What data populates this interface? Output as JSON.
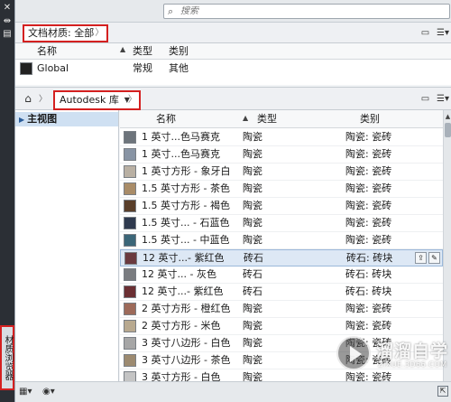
{
  "left_strip": {
    "vertical_title": "材质浏览器",
    "icons": [
      "close-icon",
      "pin-icon",
      "properties-icon"
    ]
  },
  "search": {
    "placeholder": "搜索"
  },
  "doc_materials": {
    "breadcrumb": "文档材质: 全部",
    "columns": {
      "name": "名称",
      "type": "类型",
      "category": "类别"
    },
    "rows": [
      {
        "name": "Global",
        "type": "常规",
        "category": "其他",
        "swatch": "#222222"
      }
    ]
  },
  "library": {
    "breadcrumb": "Autodesk 库",
    "tree": {
      "items": [
        {
          "label": "主视图"
        }
      ]
    },
    "columns": {
      "name": "名称",
      "type": "类型",
      "category": "类别"
    },
    "rows": [
      {
        "name": "1 英寸...色马赛克",
        "type": "陶瓷",
        "category": "陶瓷: 瓷砖",
        "swatch": "#6d747b"
      },
      {
        "name": "1 英寸...色马赛克",
        "type": "陶瓷",
        "category": "陶瓷: 瓷砖",
        "swatch": "#8894a4"
      },
      {
        "name": "1 英寸方形 - 象牙白",
        "type": "陶瓷",
        "category": "陶瓷: 瓷砖",
        "swatch": "#b9b0a3"
      },
      {
        "name": "1.5 英寸方形 - 茶色",
        "type": "陶瓷",
        "category": "陶瓷: 瓷砖",
        "swatch": "#a98c68"
      },
      {
        "name": "1.5 英寸方形 - 褐色",
        "type": "陶瓷",
        "category": "陶瓷: 瓷砖",
        "swatch": "#5a3f2a"
      },
      {
        "name": "1.5 英寸... - 石蓝色",
        "type": "陶瓷",
        "category": "陶瓷: 瓷砖",
        "swatch": "#2f3a4e"
      },
      {
        "name": "1.5 英寸... - 中蓝色",
        "type": "陶瓷",
        "category": "陶瓷: 瓷砖",
        "swatch": "#3b6678"
      },
      {
        "name": "12 英寸...- 紫红色",
        "type": "砖石",
        "category": "砖石: 砖块",
        "swatch": "#6a3a3f",
        "selected": true
      },
      {
        "name": "12 英寸... - 灰色",
        "type": "砖石",
        "category": "砖石: 砖块",
        "swatch": "#7a7c80"
      },
      {
        "name": "12 英寸...- 紫红色",
        "type": "砖石",
        "category": "砖石: 砖块",
        "swatch": "#6b2f33"
      },
      {
        "name": "2 英寸方形 - 橙红色",
        "type": "陶瓷",
        "category": "陶瓷: 瓷砖",
        "swatch": "#9d6a5a"
      },
      {
        "name": "2 英寸方形 - 米色",
        "type": "陶瓷",
        "category": "陶瓷: 瓷砖",
        "swatch": "#b8a98f"
      },
      {
        "name": "3 英寸八边形 - 白色",
        "type": "陶瓷",
        "category": "陶瓷: 瓷砖",
        "swatch": "#a6a6a6"
      },
      {
        "name": "3 英寸八边形 - 茶色",
        "type": "陶瓷",
        "category": "陶瓷: 瓷砖",
        "swatch": "#9c8a70"
      },
      {
        "name": "3 英寸方形 - 白色",
        "type": "陶瓷",
        "category": "陶瓷: 瓷砖",
        "swatch": "#c4c4c4"
      }
    ]
  },
  "watermark": {
    "title": "溜溜自学",
    "subtitle": "ZIXUE.3D66.COM"
  }
}
